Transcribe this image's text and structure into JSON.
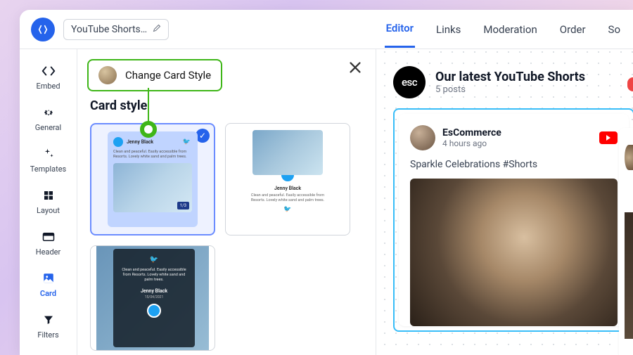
{
  "feed_name": "YouTube Shorts…",
  "tabs": {
    "editor": "Editor",
    "links": "Links",
    "moderation": "Moderation",
    "order": "Order",
    "more": "So"
  },
  "sidebar": {
    "embed": "Embed",
    "general": "General",
    "templates": "Templates",
    "layout": "Layout",
    "header": "Header",
    "card": "Card",
    "filters": "Filters"
  },
  "callout": {
    "text": "Change Card Style"
  },
  "panel": {
    "title": "Card style"
  },
  "mock": {
    "name": "Jenny Black",
    "date": "15/04/2021",
    "text": "Clean and peaceful. Easily accessible from Resorts. Lovely white sand and palm trees.",
    "count": "1/3"
  },
  "preview": {
    "logo": "esc",
    "title": "Our latest YouTube Shorts",
    "subtitle": "5 posts",
    "card": {
      "user": "EsCommerce",
      "time": "4 hours ago",
      "text": "Sparkle Celebrations #Shorts"
    }
  }
}
